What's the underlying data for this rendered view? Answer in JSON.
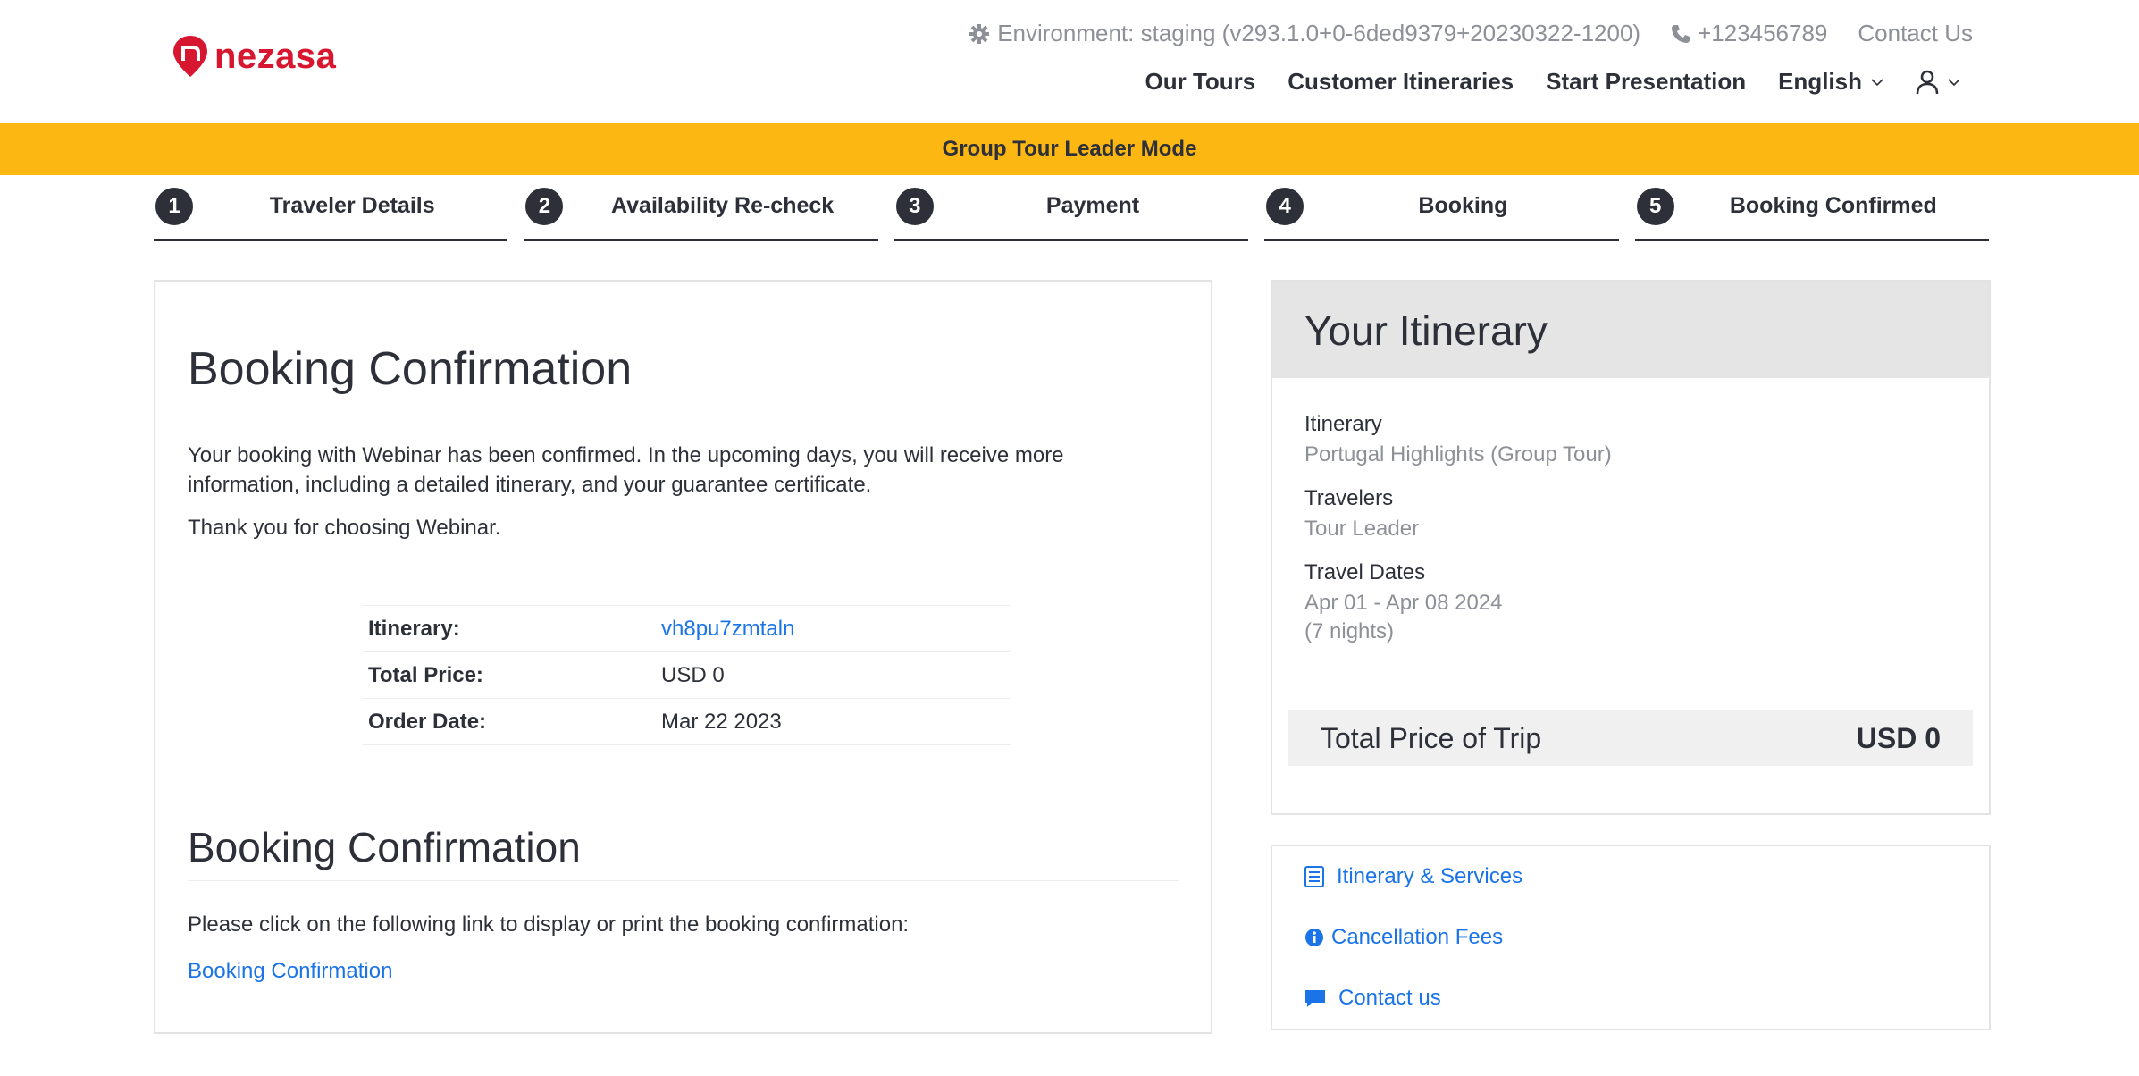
{
  "brand": {
    "name": "nezasa",
    "color": "#d7172f"
  },
  "topbar": {
    "environment": "Environment: staging (v293.1.0+0-6ded9379+20230322-1200)",
    "phone": "+123456789",
    "contact": "Contact Us"
  },
  "nav": {
    "tours": "Our Tours",
    "customer_itineraries": "Customer Itineraries",
    "start_presentation": "Start Presentation",
    "language": "English"
  },
  "banner": {
    "text": "Group Tour Leader Mode",
    "color": "#fcb712"
  },
  "steps": [
    {
      "num": "1",
      "label": "Traveler Details"
    },
    {
      "num": "2",
      "label": "Availability Re-check"
    },
    {
      "num": "3",
      "label": "Payment"
    },
    {
      "num": "4",
      "label": "Booking"
    },
    {
      "num": "5",
      "label": "Booking Confirmed"
    }
  ],
  "confirmation": {
    "title": "Booking Confirmation",
    "message": "Your booking with Webinar has been confirmed. In the upcoming days, you will receive more information, including a detailed itinerary, and your guarantee certificate.",
    "thanks": "Thank you for choosing Webinar.",
    "summary": [
      {
        "label": "Itinerary:",
        "value": "vh8pu7zmtaln"
      },
      {
        "label": "Total Price:",
        "value": "USD 0"
      },
      {
        "label": "Order Date:",
        "value": "Mar 22 2023"
      }
    ],
    "section_title": "Booking Confirmation",
    "print_text": "Please click on the following link to display or print the booking confirmation:",
    "print_link": "Booking Confirmation"
  },
  "itinerary": {
    "title": "Your Itinerary",
    "itinerary_label": "Itinerary",
    "itinerary_value": "Portugal Highlights (Group Tour)",
    "travelers_label": "Travelers",
    "travelers_value": "Tour Leader",
    "dates_label": "Travel Dates",
    "dates_value": "Apr 01 - Apr 08 2024",
    "nights": "(7 nights)",
    "total_label": "Total Price of Trip",
    "total_value": "USD 0"
  },
  "links": {
    "services": "Itinerary & Services",
    "cancellation": "Cancellation Fees",
    "contact": "Contact us"
  },
  "colors": {
    "link": "#1a74e8",
    "text": "#2d3039",
    "muted": "#8e9097"
  }
}
